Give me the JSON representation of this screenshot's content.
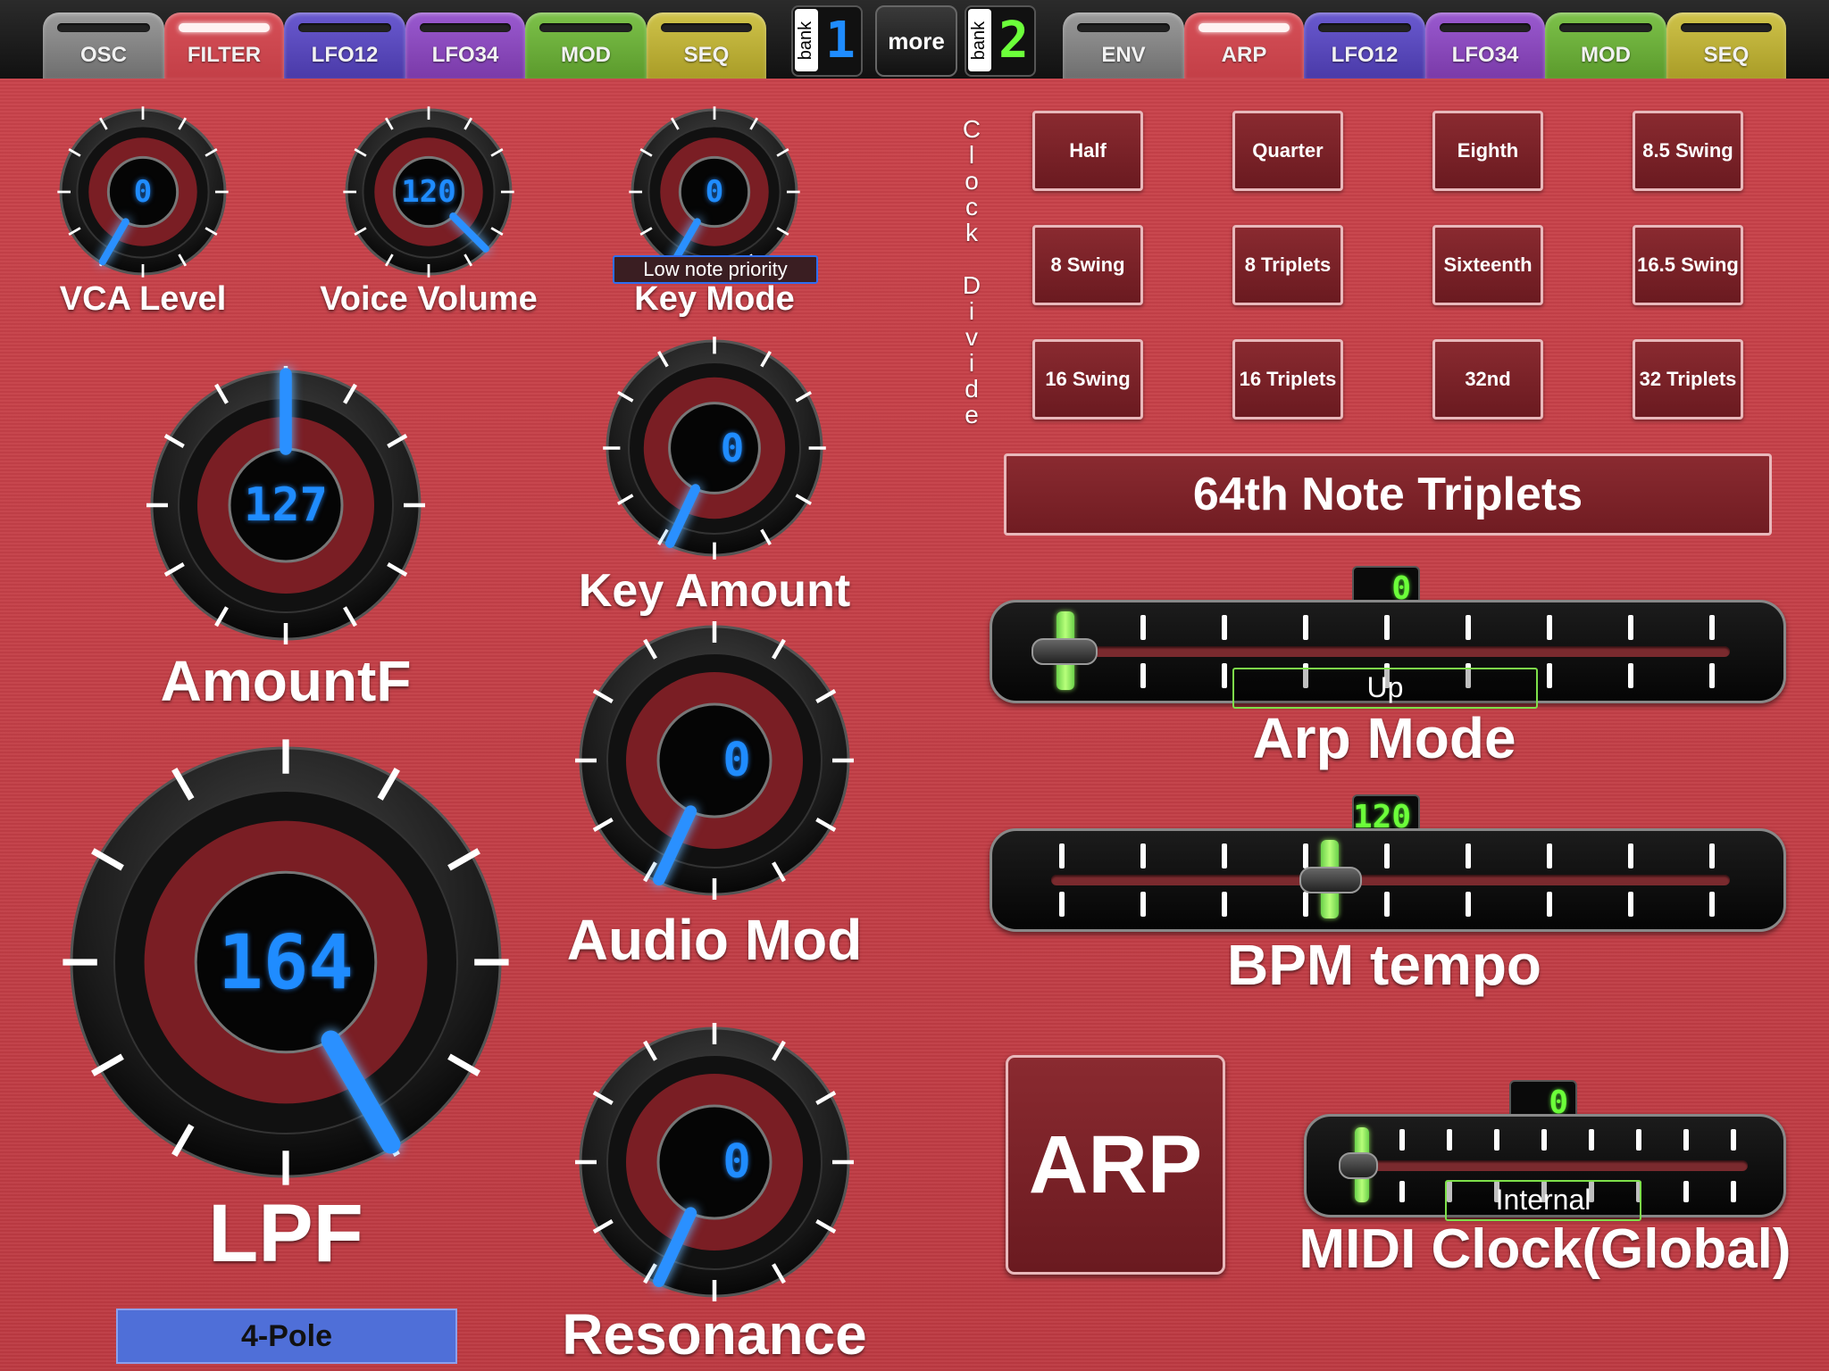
{
  "tabs_left": [
    "OSC",
    "FILTER",
    "LFO12",
    "LFO34",
    "MOD",
    "SEQ"
  ],
  "tabs_right": [
    "ENV",
    "ARP",
    "LFO12",
    "LFO34",
    "MOD",
    "SEQ"
  ],
  "bank1": {
    "label": "bank",
    "number": "1"
  },
  "bank2": {
    "label": "bank",
    "number": "2"
  },
  "more_label": "more",
  "knobs": {
    "vca_level": {
      "label": "VCA Level",
      "value": "0"
    },
    "voice_volume": {
      "label": "Voice Volume",
      "value": "120"
    },
    "key_mode": {
      "label": "Key Mode",
      "value": "0",
      "mode_text": "Low note priority"
    },
    "amount_f": {
      "label": "AmountF",
      "value": "127"
    },
    "key_amount": {
      "label": "Key Amount",
      "value": "0"
    },
    "audio_mod": {
      "label": "Audio Mod",
      "value": "0"
    },
    "lpf": {
      "label": "LPF",
      "value": "164"
    },
    "resonance": {
      "label": "Resonance",
      "value": "0"
    }
  },
  "pole_button": "4-Pole",
  "clock_divide": {
    "label_line1": "Clock",
    "label_line2": "Divide",
    "buttons": [
      "Half",
      "Quarter",
      "Eighth",
      "8.5 Swing",
      "8 Swing",
      "8 Triplets",
      "Sixteenth",
      "16.5 Swing",
      "16 Swing",
      "16 Triplets",
      "32nd",
      "32 Triplets"
    ],
    "current": "64th Note Triplets"
  },
  "arp_mode": {
    "label": "Arp Mode",
    "value": "0",
    "mode_text": "Up"
  },
  "bpm_tempo": {
    "label": "BPM tempo",
    "value": "120"
  },
  "arp_button": "ARP",
  "midi_clock": {
    "label": "MIDI Clock(Global)",
    "value": "0",
    "mode_text": "Internal"
  },
  "colors": {
    "background": "#c33f47",
    "lcd_blue": "#1f8cff",
    "lcd_green": "#6cff3a",
    "accent_green": "#7ee04a"
  }
}
